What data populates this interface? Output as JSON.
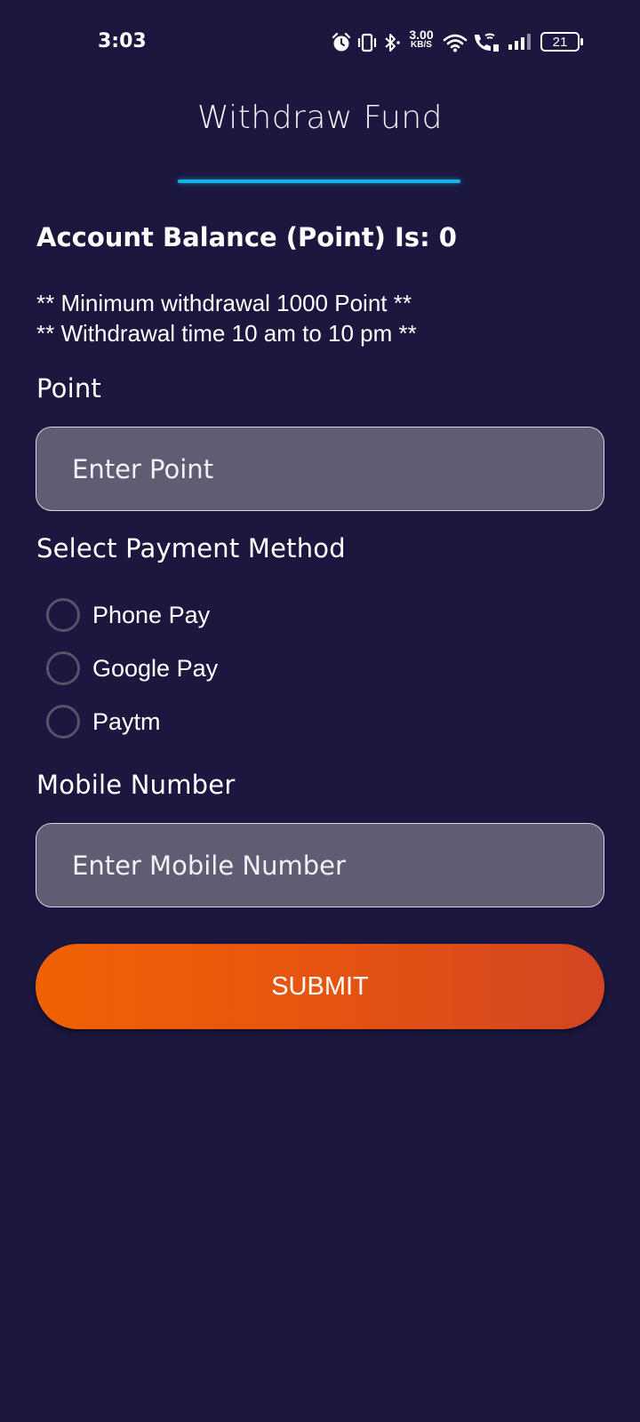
{
  "status_bar": {
    "time": "3:03",
    "network_speed_value": "3.00",
    "network_speed_unit": "KB/S",
    "battery_level": "21",
    "icons": [
      "alarm-icon",
      "vibrate-icon",
      "bluetooth-icon",
      "wifi-icon",
      "wifi-calling-icon",
      "signal-icon",
      "battery-icon"
    ]
  },
  "header": {
    "title": "Withdraw Fund",
    "underline_color": "#18b4e8"
  },
  "balance": {
    "text": "Account Balance (Point) Is: 0"
  },
  "notes": [
    "** Minimum withdrawal 1000 Point **",
    "** Withdrawal time 10 am to 10 pm **"
  ],
  "point_field": {
    "label": "Point",
    "placeholder": "Enter Point",
    "value": ""
  },
  "payment": {
    "label": "Select Payment Method",
    "options": [
      {
        "label": "Phone Pay",
        "selected": false
      },
      {
        "label": "Google Pay",
        "selected": false
      },
      {
        "label": "Paytm",
        "selected": false
      }
    ]
  },
  "mobile_field": {
    "label": "Mobile Number",
    "placeholder": "Enter Mobile Number",
    "value": ""
  },
  "submit": {
    "label": "SUBMIT",
    "gradient_start": "#ef6203",
    "gradient_end": "#d34522"
  },
  "colors": {
    "background": "#1b173f",
    "input_fill": "#5e5d73"
  }
}
